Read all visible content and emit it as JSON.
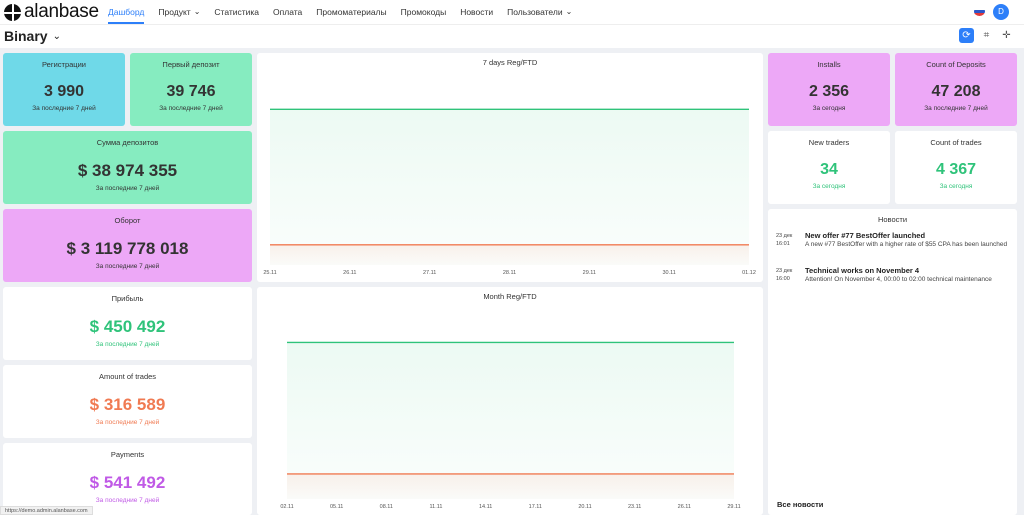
{
  "brand": {
    "logo_text": "alanbase"
  },
  "nav": {
    "items": [
      {
        "label": "Дашборд",
        "active": true,
        "dropdown": false
      },
      {
        "label": "Продукт",
        "active": false,
        "dropdown": true
      },
      {
        "label": "Статистика",
        "active": false,
        "dropdown": false
      },
      {
        "label": "Оплата",
        "active": false,
        "dropdown": false
      },
      {
        "label": "Промоматериалы",
        "active": false,
        "dropdown": false
      },
      {
        "label": "Промокоды",
        "active": false,
        "dropdown": false
      },
      {
        "label": "Новости",
        "active": false,
        "dropdown": false
      },
      {
        "label": "Пользователи",
        "active": false,
        "dropdown": true
      }
    ],
    "avatar_letter": "D"
  },
  "board": {
    "name": "Binary"
  },
  "cards": {
    "registrations": {
      "label": "Регистрации",
      "value": "3 990",
      "sub": "За последние 7 дней"
    },
    "first_deposit": {
      "label": "Первый депозит",
      "value": "39 746",
      "sub": "За последние 7 дней"
    },
    "deposit_sum": {
      "label": "Сумма депозитов",
      "value": "$ 38 974 355",
      "sub": "За последние 7 дней"
    },
    "turnover": {
      "label": "Оборот",
      "value": "$ 3 119 778 018",
      "sub": "За последние 7 дней"
    },
    "profit": {
      "label": "Прибыль",
      "value": "$ 450 492",
      "sub": "За последние 7 дней"
    },
    "amount_trades": {
      "label": "Amount of trades",
      "value": "$ 316 589",
      "sub": "За последние 7 дней"
    },
    "payments": {
      "label": "Payments",
      "value": "$ 541 492",
      "sub": "За последние 7 дней"
    },
    "installs": {
      "label": "Installs",
      "value": "2 356",
      "sub": "За сегодня"
    },
    "count_deposits": {
      "label": "Count of Deposits",
      "value": "47 208",
      "sub": "За последние 7 дней"
    },
    "new_traders": {
      "label": "New traders",
      "value": "34",
      "sub": "За сегодня"
    },
    "count_trades": {
      "label": "Count of trades",
      "value": "4 367",
      "sub": "За сегодня"
    }
  },
  "colors": {
    "cyan": "#6fd9e8",
    "mint": "#86ecc0",
    "pink": "#eda8f7",
    "green_line": "#2fc37a",
    "orange_line": "#f07a52",
    "accent": "#2d7ff9"
  },
  "chart_data": [
    {
      "type": "line",
      "title": "7 days Reg/FTD",
      "x": [
        "25.11",
        "26.11",
        "27.11",
        "28.11",
        "29.11",
        "30.11",
        "01.12"
      ],
      "series": [
        {
          "values": [
            100,
            100,
            100,
            100,
            100,
            100,
            100
          ],
          "color": "#2fc37a"
        },
        {
          "values": [
            13,
            13,
            13,
            13,
            13,
            13,
            13
          ],
          "color": "#f07a52"
        }
      ],
      "ylim": [
        0,
        115
      ],
      "grid": false
    },
    {
      "type": "line",
      "title": "Month Reg/FTD",
      "x": [
        "02.11",
        "05.11",
        "08.11",
        "11.11",
        "14.11",
        "17.11",
        "20.11",
        "23.11",
        "26.11",
        "29.11"
      ],
      "series": [
        {
          "values": [
            100,
            100,
            100,
            100,
            100,
            100,
            100,
            100,
            100,
            100
          ],
          "color": "#2fc37a"
        },
        {
          "values": [
            16,
            16,
            16,
            16,
            16,
            16,
            16,
            16,
            16,
            16
          ],
          "color": "#f07a52"
        }
      ],
      "ylim": [
        0,
        115
      ],
      "grid": false
    }
  ],
  "news": {
    "title": "Новости",
    "items": [
      {
        "date_day": "23 дек",
        "date_time": "16:01",
        "headline": "New offer #77 BestOffer launched",
        "body": "A new #77 BestOffer with a higher rate of $55 CPA has been launched"
      },
      {
        "date_day": "23 дек",
        "date_time": "16:00",
        "headline": "Technical works on November 4",
        "body": "Attention! On November 4, 00:00 to 02:00 technical maintenance"
      }
    ],
    "all_link": "Все новости"
  },
  "status_url": "https://demo.admin.alanbase.com"
}
